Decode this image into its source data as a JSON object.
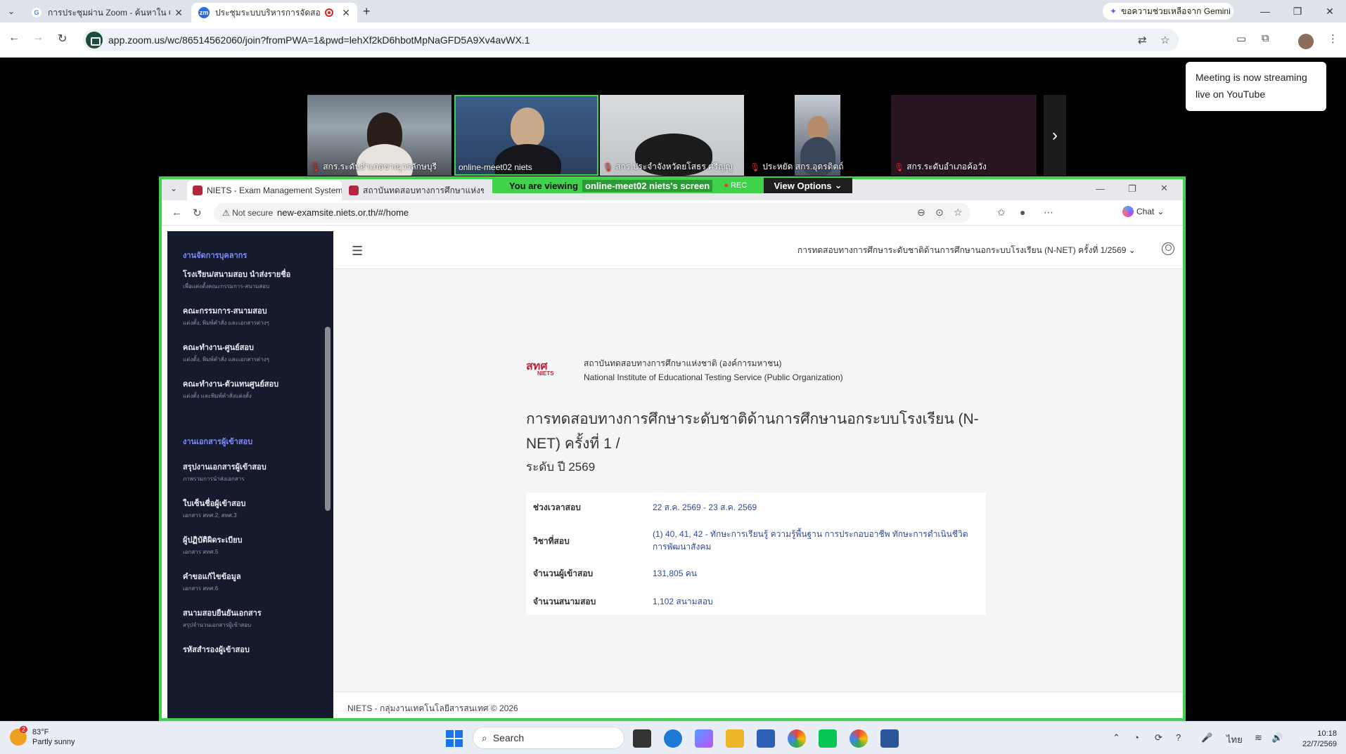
{
  "outer_browser": {
    "tabs": [
      {
        "label": "การประชุมผ่าน Zoom - ค้นหาใน Go",
        "icon": "google-icon"
      },
      {
        "label": "ประชุมระบบบริหารการจัดสอบ(ศ",
        "icon": "zoom-icon"
      }
    ],
    "gemini_label": "ขอความช่วยเหลือจาก Gemini",
    "url": "app.zoom.us/wc/86514562060/join?fromPWA=1&pwd=lehXf2kD6hbotMpNaGFD5A9Xv4avWX.1"
  },
  "zoom": {
    "toast": "Meeting is now streaming live on YouTube",
    "participants": [
      {
        "name": "สกร.ระดับอำเภอขาณุวรลักษบุรี",
        "muted": true
      },
      {
        "name": "online-meet02 niets",
        "muted": false
      },
      {
        "name": "สกร.ประจำจังหวัดยโสธร ศรีญญู",
        "muted": true
      },
      {
        "name": "ประหยัด สกร.อุดรดิตถ์",
        "muted": true
      },
      {
        "name": "สกร.ระดับอำเภอค้อวัง",
        "muted": true
      }
    ],
    "banner_prefix": "You are viewing",
    "banner_sharer": "online-meet02 niets's screen",
    "rec_label": "REC",
    "view_options": "View Options"
  },
  "inner_browser": {
    "tab_active": "NIETS - Exam Management System",
    "tab_other": "สถาบันทดสอบทางการศึกษาแห่งชาติ (อ",
    "not_secure": "Not secure",
    "url": "new-examsite.niets.or.th/#/home",
    "chat_label": "Chat"
  },
  "sidebar": {
    "sections": [
      {
        "title": "งานจัดการบุคลากร",
        "items": [
          {
            "title": "โรงเรียน/สนามสอบ นำส่งรายชื่อ",
            "sub": "เพื่อแต่งตั้งคณะกรรมการ-สนามสอบ"
          },
          {
            "title": "คณะกรรมการ-สนามสอบ",
            "sub": "แต่งตั้ง, พิมพ์คำสั่ง และเอกสารต่างๆ"
          },
          {
            "title": "คณะทำงาน-ศูนย์สอบ",
            "sub": "แต่งตั้ง, พิมพ์คำสั่ง และเอกสารต่างๆ"
          },
          {
            "title": "คณะทำงาน-ตัวแทนศูนย์สอบ",
            "sub": "แต่งตั้ง และพิมพ์คำสั่งแต่งตั้ง"
          }
        ]
      },
      {
        "title": "งานเอกสารผู้เข้าสอบ",
        "items": [
          {
            "title": "สรุปงานเอกสารผู้เข้าสอบ",
            "sub": "ภาพรวมการนำส่งเอกสาร"
          },
          {
            "title": "ใบเซ็นชื่อผู้เข้าสอบ",
            "sub": "เอกสาร สทศ.2, สทศ.3"
          },
          {
            "title": "ผู้ปฏิบัติผิดระเบียบ",
            "sub": "เอกสาร สทศ.5"
          },
          {
            "title": "คำขอแก้ไขข้อมูล",
            "sub": "เอกสาร สทศ.6"
          },
          {
            "title": "สนามสอบยืนยันเอกสาร",
            "sub": "สรุปจำนวนเอกสารผู้เข้าสอบ"
          },
          {
            "title": "รหัสสำรองผู้เข้าสอบ",
            "sub": ""
          }
        ]
      }
    ]
  },
  "main": {
    "exam_selector": "การทดสอบทางการศึกษาระดับชาติด้านการศึกษานอกระบบโรงเรียน (N-NET) ครั้งที่ 1/2569",
    "org_logo_text": "สทศ",
    "org_logo_sub": "NIETS",
    "org_name_th": "สถาบันทดสอบทางการศึกษาแห่งชาติ (องค์การมหาชน)",
    "org_name_en": "National Institute of Educational Testing Service (Public Organization)",
    "exam_title": "การทดสอบทางการศึกษาระดับชาติด้านการศึกษานอกระบบโรงเรียน (N-NET) ครั้งที่ 1 /",
    "exam_level": "ระดับ ปี 2569",
    "info": [
      {
        "key": "ช่วงเวลาสอบ",
        "value": "22 ส.ค. 2569 - 23 ส.ค. 2569"
      },
      {
        "key": "วิชาที่สอบ",
        "value": "(1) 40, 41, 42 - ทักษะการเรียนรู้ ความรู้พื้นฐาน การประกอบอาชีพ ทักษะการดำเนินชีวิต การพัฒนาสังคม"
      },
      {
        "key": "จำนวนผู้เข้าสอบ",
        "value": "131,805 คน"
      },
      {
        "key": "จำนวนสนามสอบ",
        "value": "1,102 สนามสอบ"
      }
    ],
    "footer": "NIETS - กลุ่มงานเทคโนโลยีสารสนเทศ © 2026"
  },
  "taskbar": {
    "weather_temp": "83°F",
    "weather_desc": "Partly sunny",
    "weather_badge": "2",
    "search_placeholder": "Search",
    "lang": "ไทย",
    "time": "10:18",
    "date": "22/7/2569"
  },
  "colors": {
    "zoom_share_border": "#3fd24a",
    "sidebar_bg": "#151a2d",
    "sidebar_section": "#7d8cff",
    "info_value": "#2d4a9d"
  }
}
